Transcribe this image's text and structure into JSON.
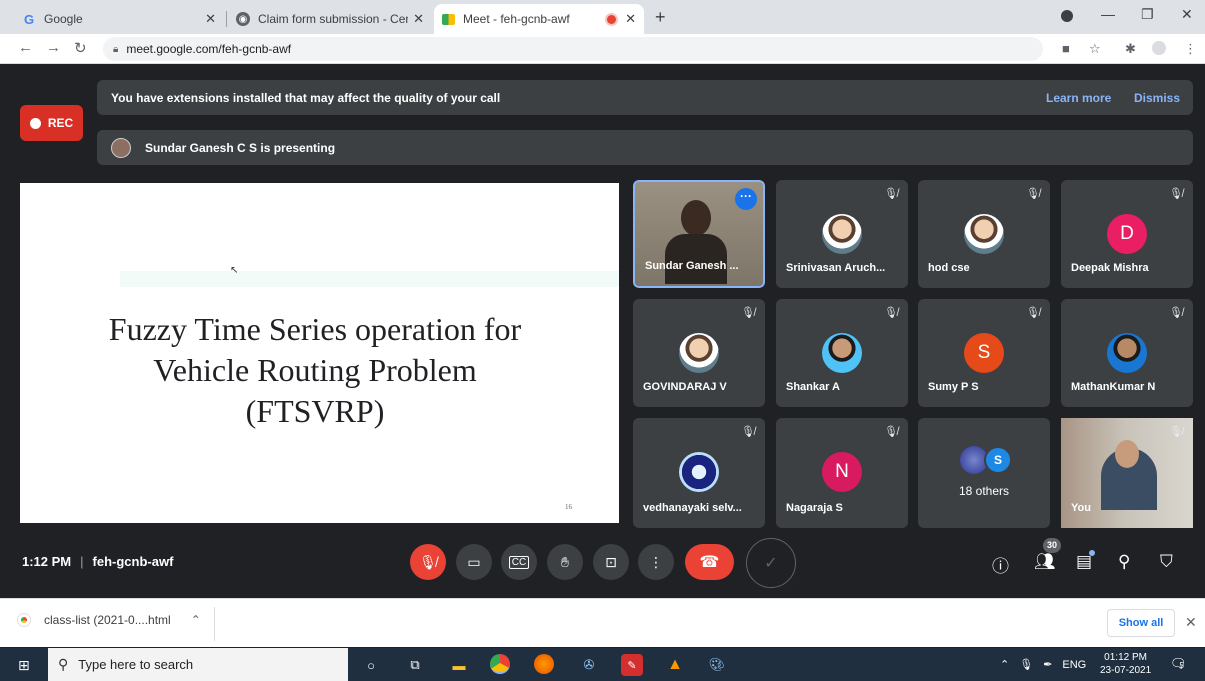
{
  "browser": {
    "tabs": [
      {
        "title": "Google",
        "favicon": "google-icon"
      },
      {
        "title": "Claim form submission - Centre f",
        "favicon": "globe-icon"
      },
      {
        "title": "Meet - feh-gcnb-awf",
        "favicon": "meet-icon",
        "recording": true
      }
    ],
    "url": "meet.google.com/feh-gcnb-awf"
  },
  "meet": {
    "rec_label": "REC",
    "extension_notice": "You have extensions installed that may affect the quality of your call",
    "learn_more": "Learn more",
    "dismiss": "Dismiss",
    "presenting_notice": "Sundar Ganesh C S is presenting",
    "slide": {
      "title_lines": [
        "Fuzzy Time Series operation for",
        "Vehicle Routing Problem",
        "(FTSVRP)"
      ],
      "page": "16"
    },
    "participants": [
      {
        "name": "Sundar Ganesh ...",
        "type": "video",
        "muted": false
      },
      {
        "name": "Srinivasan Aruch...",
        "type": "photo",
        "muted": true
      },
      {
        "name": "hod cse",
        "type": "photo",
        "muted": true
      },
      {
        "name": "Deepak Mishra",
        "type": "initial",
        "initial": "D",
        "color": "#e91e63",
        "muted": true
      },
      {
        "name": "GOVINDARAJ V",
        "type": "photo",
        "muted": true
      },
      {
        "name": "Shankar A",
        "type": "photo",
        "muted": true
      },
      {
        "name": "Sumy P S",
        "type": "initial",
        "initial": "S",
        "color": "#e64a19",
        "muted": true
      },
      {
        "name": "MathanKumar N",
        "type": "photo",
        "muted": true
      },
      {
        "name": "vedhanayaki selv...",
        "type": "photo",
        "muted": true
      },
      {
        "name": "Nagaraja S",
        "type": "initial",
        "initial": "N",
        "color": "#d81b60",
        "muted": true
      },
      {
        "name": "18 others",
        "type": "others",
        "initial": "S",
        "color": "#1e88e5",
        "muted": false
      },
      {
        "name": "You",
        "type": "video",
        "muted": true
      }
    ],
    "time": "1:12 PM",
    "meeting_code": "feh-gcnb-awf",
    "participant_count": "30"
  },
  "downloads": {
    "file": "class-list (2021-0....html",
    "show_all": "Show all"
  },
  "taskbar": {
    "search_placeholder": "Type here to search",
    "lang": "ENG",
    "time": "01:12 PM",
    "date": "23-07-2021",
    "notifications": "5"
  }
}
